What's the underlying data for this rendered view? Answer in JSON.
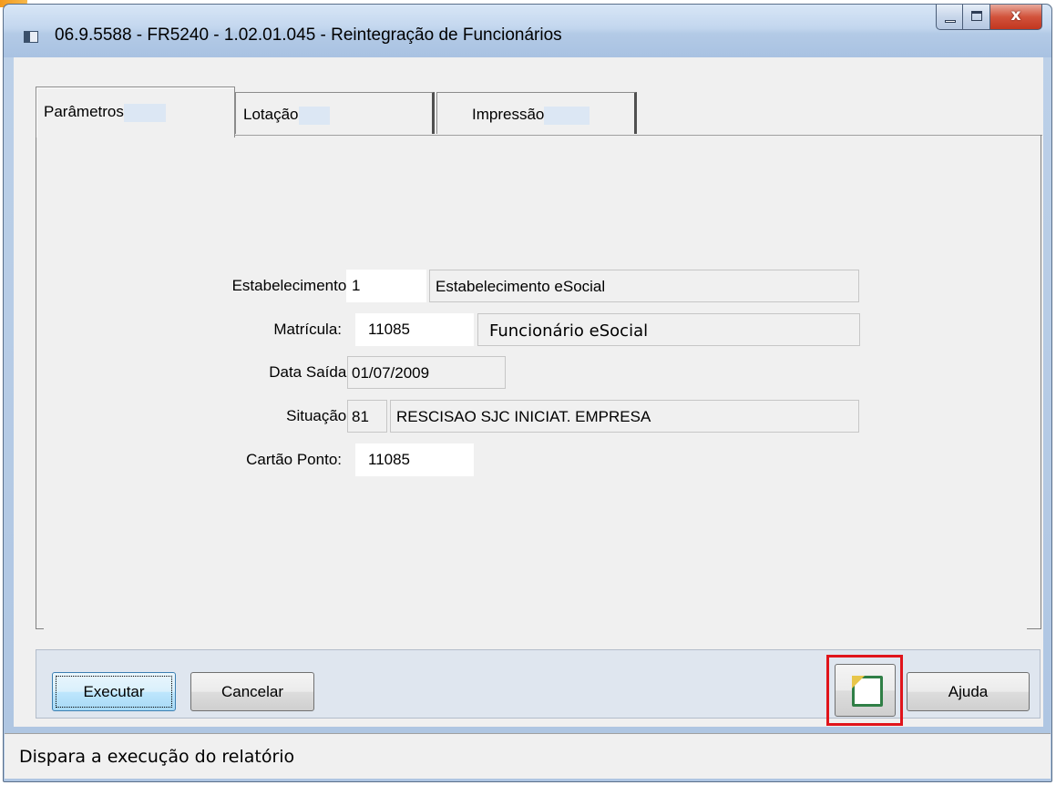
{
  "window": {
    "title": "06.9.5588 - FR5240 - 1.02.01.045 - Reintegração de Funcionários",
    "close_glyph": "x"
  },
  "tabs": [
    {
      "label": "Parâmetros",
      "active": true
    },
    {
      "label": "Lotação",
      "active": false
    },
    {
      "label": "Impressão",
      "active": false
    }
  ],
  "form": {
    "estabelecimento": {
      "label": "Estabelecimento:",
      "code": "1",
      "description": "Estabelecimento eSocial"
    },
    "matricula": {
      "label": "Matrícula:",
      "code": "11085",
      "description": "Funcionário eSocial"
    },
    "data_saida": {
      "label": "Data Saída:",
      "value": "01/07/2009"
    },
    "situacao": {
      "label": "Situação:",
      "code": "81",
      "description": "RESCISAO SJC INICIAT. EMPRESA"
    },
    "cartao_ponto": {
      "label": "Cartão Ponto:",
      "value": "11085"
    }
  },
  "buttons": {
    "executar": "Executar",
    "cancelar": "Cancelar",
    "ajuda": "Ajuda",
    "document_icon": "new-document-icon"
  },
  "status": {
    "text": "Dispara a execução do relatório"
  },
  "colors": {
    "highlight_box": "#e0141b",
    "tab_label_highlight": "#dce7f4"
  }
}
